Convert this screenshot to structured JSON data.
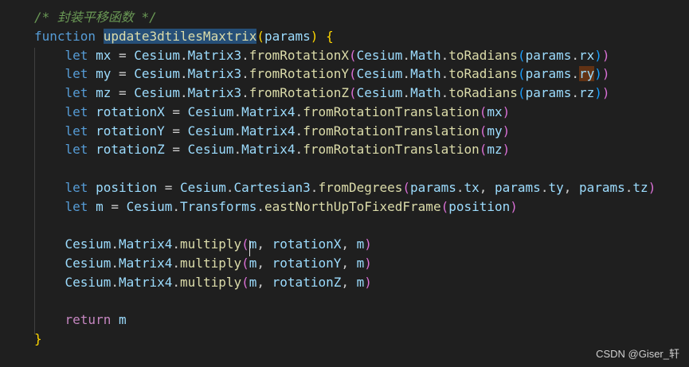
{
  "editor": {
    "lines": [
      [
        [
          "tok-comment",
          "/* 封装平移函数 */"
        ]
      ],
      [
        [
          "tok-keyword",
          "function "
        ],
        [
          "tok-func hl-fn",
          "update3dtilesMaxtrix"
        ],
        [
          "tok-brace1",
          "("
        ],
        [
          "tok-ident",
          "params"
        ],
        [
          "tok-brace1",
          ")"
        ],
        [
          "tok-punct",
          " "
        ],
        [
          "tok-brace1",
          "{"
        ]
      ],
      [
        [
          "tok-keyword",
          "    let "
        ],
        [
          "tok-ident",
          "mx"
        ],
        [
          "tok-punct",
          " = "
        ],
        [
          "tok-ident",
          "Cesium"
        ],
        [
          "tok-punct",
          "."
        ],
        [
          "tok-ident",
          "Matrix3"
        ],
        [
          "tok-punct",
          "."
        ],
        [
          "tok-func",
          "fromRotationX"
        ],
        [
          "tok-brace2",
          "("
        ],
        [
          "tok-ident",
          "Cesium"
        ],
        [
          "tok-punct",
          "."
        ],
        [
          "tok-ident",
          "Math"
        ],
        [
          "tok-punct",
          "."
        ],
        [
          "tok-func",
          "toRadians"
        ],
        [
          "tok-brace3",
          "("
        ],
        [
          "tok-ident",
          "params"
        ],
        [
          "tok-punct",
          "."
        ],
        [
          "tok-ident",
          "rx"
        ],
        [
          "tok-brace3",
          ")"
        ],
        [
          "tok-brace2",
          ")"
        ]
      ],
      [
        [
          "tok-keyword",
          "    let "
        ],
        [
          "tok-ident",
          "my"
        ],
        [
          "tok-punct",
          " = "
        ],
        [
          "tok-ident",
          "Cesium"
        ],
        [
          "tok-punct",
          "."
        ],
        [
          "tok-ident",
          "Matrix3"
        ],
        [
          "tok-punct",
          "."
        ],
        [
          "tok-func",
          "fromRotationY"
        ],
        [
          "tok-brace2",
          "("
        ],
        [
          "tok-ident",
          "Cesium"
        ],
        [
          "tok-punct",
          "."
        ],
        [
          "tok-ident",
          "Math"
        ],
        [
          "tok-punct",
          "."
        ],
        [
          "tok-func",
          "toRadians"
        ],
        [
          "tok-brace3",
          "("
        ],
        [
          "tok-ident",
          "params"
        ],
        [
          "tok-punct",
          "."
        ],
        [
          "tok-ident hl-ry",
          "ry"
        ],
        [
          "tok-brace3",
          ")"
        ],
        [
          "tok-brace2",
          ")"
        ]
      ],
      [
        [
          "tok-keyword",
          "    let "
        ],
        [
          "tok-ident",
          "mz"
        ],
        [
          "tok-punct",
          " = "
        ],
        [
          "tok-ident",
          "Cesium"
        ],
        [
          "tok-punct",
          "."
        ],
        [
          "tok-ident",
          "Matrix3"
        ],
        [
          "tok-punct",
          "."
        ],
        [
          "tok-func",
          "fromRotationZ"
        ],
        [
          "tok-brace2",
          "("
        ],
        [
          "tok-ident",
          "Cesium"
        ],
        [
          "tok-punct",
          "."
        ],
        [
          "tok-ident",
          "Math"
        ],
        [
          "tok-punct",
          "."
        ],
        [
          "tok-func",
          "toRadians"
        ],
        [
          "tok-brace3",
          "("
        ],
        [
          "tok-ident",
          "params"
        ],
        [
          "tok-punct",
          "."
        ],
        [
          "tok-ident",
          "rz"
        ],
        [
          "tok-brace3",
          ")"
        ],
        [
          "tok-brace2",
          ")"
        ]
      ],
      [
        [
          "tok-keyword",
          "    let "
        ],
        [
          "tok-ident",
          "rotationX"
        ],
        [
          "tok-punct",
          " = "
        ],
        [
          "tok-ident",
          "Cesium"
        ],
        [
          "tok-punct",
          "."
        ],
        [
          "tok-ident",
          "Matrix4"
        ],
        [
          "tok-punct",
          "."
        ],
        [
          "tok-func",
          "fromRotationTranslation"
        ],
        [
          "tok-brace2",
          "("
        ],
        [
          "tok-ident",
          "mx"
        ],
        [
          "tok-brace2",
          ")"
        ]
      ],
      [
        [
          "tok-keyword",
          "    let "
        ],
        [
          "tok-ident",
          "rotationY"
        ],
        [
          "tok-punct",
          " = "
        ],
        [
          "tok-ident",
          "Cesium"
        ],
        [
          "tok-punct",
          "."
        ],
        [
          "tok-ident",
          "Matrix4"
        ],
        [
          "tok-punct",
          "."
        ],
        [
          "tok-func",
          "fromRotationTranslation"
        ],
        [
          "tok-brace2",
          "("
        ],
        [
          "tok-ident",
          "my"
        ],
        [
          "tok-brace2",
          ")"
        ]
      ],
      [
        [
          "tok-keyword",
          "    let "
        ],
        [
          "tok-ident",
          "rotationZ"
        ],
        [
          "tok-punct",
          " = "
        ],
        [
          "tok-ident",
          "Cesium"
        ],
        [
          "tok-punct",
          "."
        ],
        [
          "tok-ident",
          "Matrix4"
        ],
        [
          "tok-punct",
          "."
        ],
        [
          "tok-func",
          "fromRotationTranslation"
        ],
        [
          "tok-brace2",
          "("
        ],
        [
          "tok-ident",
          "mz"
        ],
        [
          "tok-brace2",
          ")"
        ]
      ],
      [],
      [
        [
          "tok-keyword",
          "    let "
        ],
        [
          "tok-ident",
          "position"
        ],
        [
          "tok-punct",
          " = "
        ],
        [
          "tok-ident",
          "Cesium"
        ],
        [
          "tok-punct",
          "."
        ],
        [
          "tok-ident",
          "Cartesian3"
        ],
        [
          "tok-punct",
          "."
        ],
        [
          "tok-func",
          "fromDegrees"
        ],
        [
          "tok-brace2",
          "("
        ],
        [
          "tok-ident",
          "params"
        ],
        [
          "tok-punct",
          "."
        ],
        [
          "tok-ident",
          "tx"
        ],
        [
          "tok-punct",
          ", "
        ],
        [
          "tok-ident",
          "params"
        ],
        [
          "tok-punct",
          "."
        ],
        [
          "tok-ident",
          "ty"
        ],
        [
          "tok-punct",
          ", "
        ],
        [
          "tok-ident",
          "params"
        ],
        [
          "tok-punct",
          "."
        ],
        [
          "tok-ident",
          "tz"
        ],
        [
          "tok-brace2",
          ")"
        ]
      ],
      [
        [
          "tok-keyword",
          "    let "
        ],
        [
          "tok-ident",
          "m"
        ],
        [
          "tok-punct",
          " = "
        ],
        [
          "tok-ident",
          "Cesium"
        ],
        [
          "tok-punct",
          "."
        ],
        [
          "tok-ident",
          "Transforms"
        ],
        [
          "tok-punct",
          "."
        ],
        [
          "tok-func",
          "eastNorthUpToFixedFrame"
        ],
        [
          "tok-brace2",
          "("
        ],
        [
          "tok-ident",
          "position"
        ],
        [
          "tok-brace2",
          ")"
        ]
      ],
      [],
      [
        [
          "tok-punct",
          "    "
        ],
        [
          "tok-ident",
          "Cesium"
        ],
        [
          "tok-punct",
          "."
        ],
        [
          "tok-ident",
          "Matrix4"
        ],
        [
          "tok-punct",
          "."
        ],
        [
          "tok-func",
          "multiply"
        ],
        [
          "tok-brace2",
          "("
        ],
        [
          "tok-ident",
          "m"
        ],
        [
          "tok-punct",
          ", "
        ],
        [
          "tok-ident",
          "rotationX"
        ],
        [
          "tok-punct",
          ", "
        ],
        [
          "tok-ident",
          "m"
        ],
        [
          "tok-brace2",
          ")"
        ]
      ],
      [
        [
          "tok-punct",
          "    "
        ],
        [
          "tok-ident",
          "Cesium"
        ],
        [
          "tok-punct",
          "."
        ],
        [
          "tok-ident",
          "Matrix4"
        ],
        [
          "tok-punct",
          "."
        ],
        [
          "tok-func",
          "multiply"
        ],
        [
          "tok-brace2",
          "("
        ],
        [
          "tok-ident",
          "m"
        ],
        [
          "tok-punct",
          ", "
        ],
        [
          "tok-ident",
          "rotationY"
        ],
        [
          "tok-punct",
          ", "
        ],
        [
          "tok-ident",
          "m"
        ],
        [
          "tok-brace2",
          ")"
        ]
      ],
      [
        [
          "tok-punct",
          "    "
        ],
        [
          "tok-ident",
          "Cesium"
        ],
        [
          "tok-punct",
          "."
        ],
        [
          "tok-ident",
          "Matrix4"
        ],
        [
          "tok-punct",
          "."
        ],
        [
          "tok-func",
          "multiply"
        ],
        [
          "tok-brace2",
          "("
        ],
        [
          "tok-ident",
          "m"
        ],
        [
          "tok-punct",
          ", "
        ],
        [
          "tok-ident",
          "rotationZ"
        ],
        [
          "tok-punct",
          ", "
        ],
        [
          "tok-ident",
          "m"
        ],
        [
          "tok-brace2",
          ")"
        ]
      ],
      [],
      [
        [
          "tok-control",
          "    return "
        ],
        [
          "tok-ident",
          "m"
        ]
      ],
      [
        [
          "tok-brace1",
          "}"
        ]
      ]
    ]
  },
  "watermark": "CSDN @Giser_轩"
}
